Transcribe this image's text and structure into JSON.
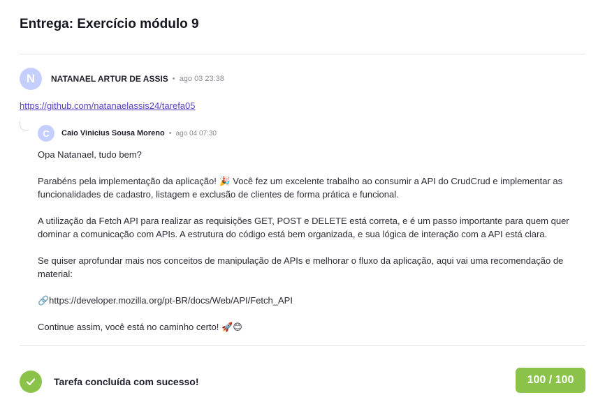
{
  "page": {
    "title": "Entrega: Exercício módulo 9"
  },
  "submission": {
    "avatar_initial": "N",
    "author": "NATANAEL ARTUR DE ASSIS",
    "separator": "•",
    "timestamp": "ago 03 23:38",
    "link": "https://github.com/natanaelassis24/tarefa05"
  },
  "reply": {
    "avatar_initial": "C",
    "author": "Caio Vinicius Sousa Moreno",
    "separator": "•",
    "timestamp": "ago 04 07:30",
    "paragraphs": [
      "Opa Natanael, tudo bem?",
      "Parabéns pela implementação da aplicação! 🎉 Você fez um excelente trabalho ao consumir a API do CrudCrud e implementar as funcionalidades de cadastro, listagem e exclusão de clientes de forma prática e funcional.",
      "A utilização da Fetch API para realizar as requisições GET, POST e DELETE está correta, e é um passo importante para quem quer dominar a comunicação com APIs. A estrutura do código está bem organizada, e sua lógica de interação com a API está clara.",
      "Se quiser aprofundar mais nos conceitos de manipulação de APIs e melhorar o fluxo da aplicação, aqui vai uma recomendação de material:",
      "🔗https://developer.mozilla.org/pt-BR/docs/Web/API/Fetch_API",
      "Continue assim, você está no caminho certo! 🚀😊"
    ]
  },
  "result": {
    "status_text": "Tarefa concluída com sucesso!",
    "score": "100 / 100",
    "icon": "check-icon",
    "accent_color": "#8bc34a"
  }
}
